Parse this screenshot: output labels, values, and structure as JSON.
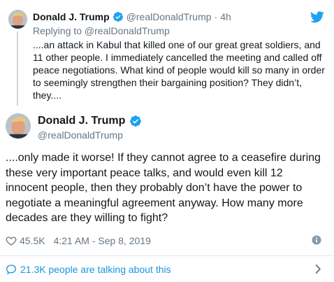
{
  "parent_tweet": {
    "name": "Donald J. Trump",
    "handle": "@realDonaldTrump",
    "separator": "·",
    "time": "4h",
    "replying_to": "Replying to @realDonaldTrump",
    "text": "....an attack in Kabul that killed one of our great great soldiers, and\n11 other people. I immediately cancelled the meeting and called off\npeace negotiations. What kind of people would kill so many in order\nto seemingly strengthen their bargaining position? They didn’t,\nthey...."
  },
  "main_tweet": {
    "name": "Donald J. Trump",
    "handle": "@realDonaldTrump",
    "text": "....only made it worse! If they cannot agree to a ceasefire during\nthese very important peace talks, and would even kill 12\ninnocent people, then they probably don’t have the power to\nnegotiate a meaningful agreement anyway. How many more\ndecades are they willing to fight?",
    "likes": "45.5K",
    "timestamp": "4:21 AM - Sep 8, 2019"
  },
  "footer": {
    "text": "21.3K people are talking about this"
  },
  "colors": {
    "verified_blue": "#1da1f2",
    "link_blue": "#1b95e0",
    "muted_gray": "#657786",
    "divider": "#e1e8ed"
  },
  "icons": {
    "verified": "verified-badge-icon",
    "brand": "twitter-bird-icon",
    "like": "heart-icon",
    "info": "info-icon",
    "comment": "comment-bubble-icon",
    "more": "chevron-right-icon"
  }
}
